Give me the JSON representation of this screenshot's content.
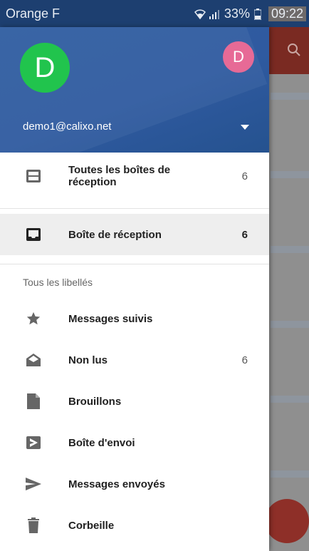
{
  "status_bar": {
    "carrier": "Orange F",
    "battery": "33%",
    "time": "09:22"
  },
  "account": {
    "avatar_letter": "D",
    "alt_avatar_letter": "D",
    "email": "demo1@calixo.net",
    "avatar_color": "#21c44d",
    "alt_avatar_color": "#e76a96",
    "header_color": "#2f5da1"
  },
  "inboxes": [
    {
      "label": "Toutes les boîtes de réception",
      "count": "6",
      "icon": "all-inboxes-icon"
    },
    {
      "label": "Boîte de réception",
      "count": "6",
      "icon": "inbox-icon",
      "selected": true
    }
  ],
  "labels_section": {
    "title": "Tous les libellés",
    "items": [
      {
        "label": "Messages suivis",
        "count": "",
        "icon": "star-icon"
      },
      {
        "label": "Non lus",
        "count": "6",
        "icon": "unread-mail-icon"
      },
      {
        "label": "Brouillons",
        "count": "",
        "icon": "draft-icon"
      },
      {
        "label": "Boîte d'envoi",
        "count": "",
        "icon": "outbox-icon"
      },
      {
        "label": "Messages envoyés",
        "count": "",
        "icon": "send-icon"
      },
      {
        "label": "Corbeille",
        "count": "",
        "icon": "trash-icon"
      }
    ]
  }
}
